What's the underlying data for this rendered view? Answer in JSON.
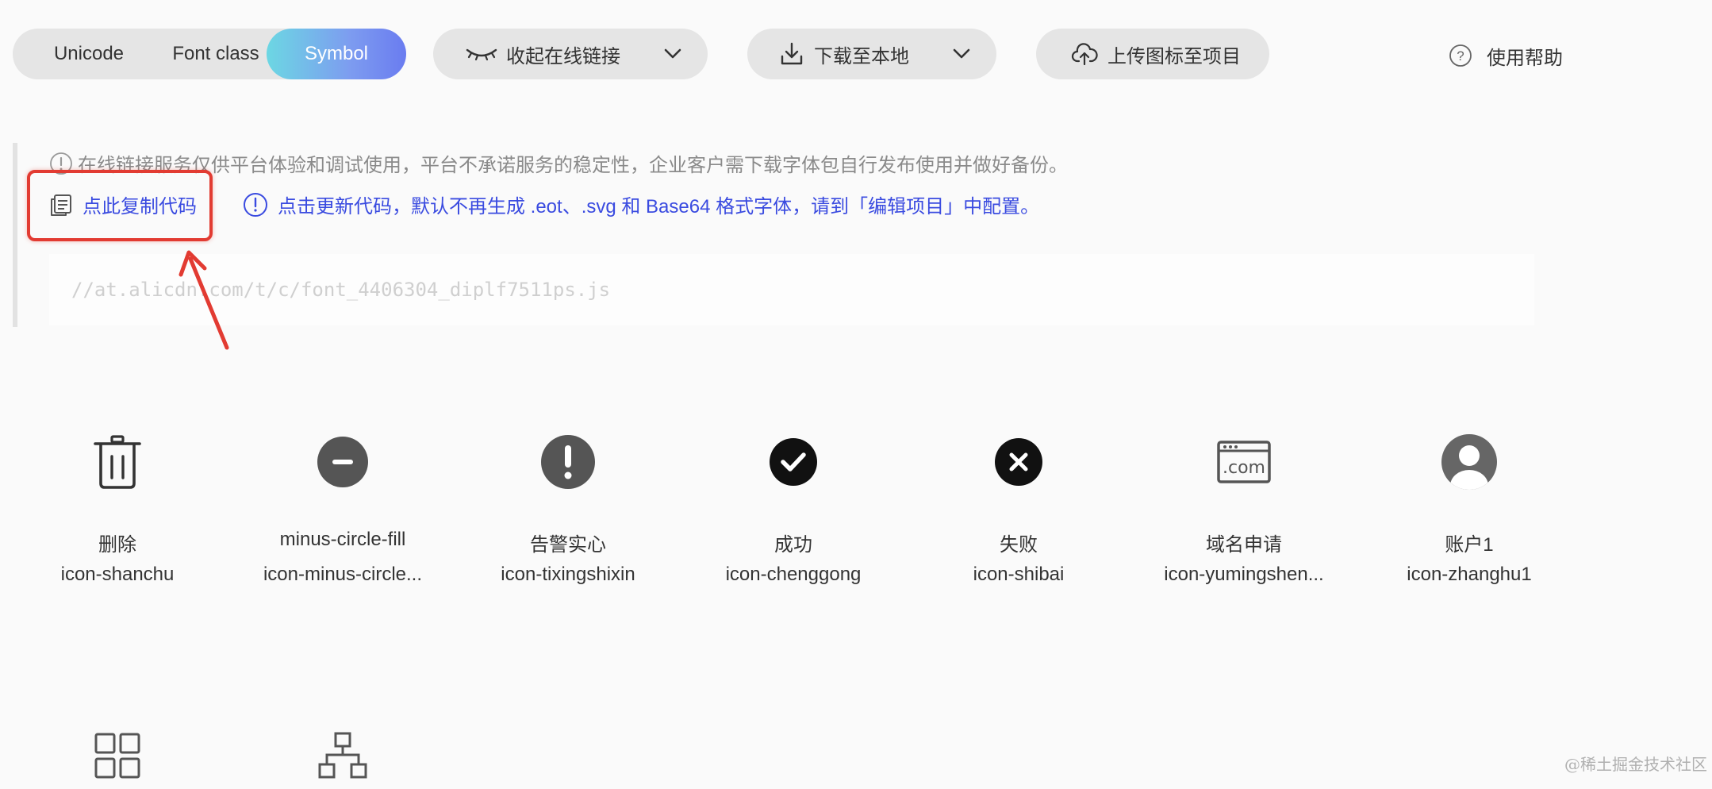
{
  "toolbar": {
    "tabs": [
      {
        "label": "Unicode",
        "active": false
      },
      {
        "label": "Font class",
        "active": false
      },
      {
        "label": "Symbol",
        "active": true
      }
    ],
    "online_link_label": "收起在线链接",
    "download_label": "下载至本地",
    "upload_label": "上传图标至项目",
    "help_label": "使用帮助"
  },
  "notices": {
    "warning": "在线链接服务仅供平台体验和调试使用，平台不承诺服务的稳定性，企业客户需下载字体包自行发布使用并做好备份。",
    "copy_code_label": "点此复制代码",
    "refresh_note": "点击更新代码，默认不再生成 .eot、.svg 和 Base64 格式字体，请到「编辑项目」中配置。"
  },
  "code_block": {
    "url": "//at.alicdn.com/t/c/font_4406304_diplf7511ps.js"
  },
  "icons": {
    "items": [
      {
        "name": "删除",
        "code": "icon-shanchu",
        "icon": "trash-icon"
      },
      {
        "name": "minus-circle-fill",
        "code": "icon-minus-circle...",
        "icon": "minus-circle-fill-icon"
      },
      {
        "name": "告警实心",
        "code": "icon-tixingshixin",
        "icon": "alert-fill-icon"
      },
      {
        "name": "成功",
        "code": "icon-chenggong",
        "icon": "check-circle-icon"
      },
      {
        "name": "失败",
        "code": "icon-shibai",
        "icon": "close-circle-icon"
      },
      {
        "name": "域名申请",
        "code": "icon-yumingshen...",
        "icon": "domain-com-icon"
      },
      {
        "name": "账户1",
        "code": "icon-zhanghu1",
        "icon": "account-icon"
      },
      {
        "name": "",
        "code": "",
        "icon": "grid-icon"
      },
      {
        "name": "",
        "code": "",
        "icon": "org-tree-icon"
      }
    ]
  },
  "watermark": "@稀土掘金技术社区",
  "colors": {
    "accent_blue": "#3a4be0",
    "highlight_red": "#e23b32",
    "tab_gradient_start": "#6cd7e3",
    "tab_gradient_end": "#6a7cf0"
  }
}
